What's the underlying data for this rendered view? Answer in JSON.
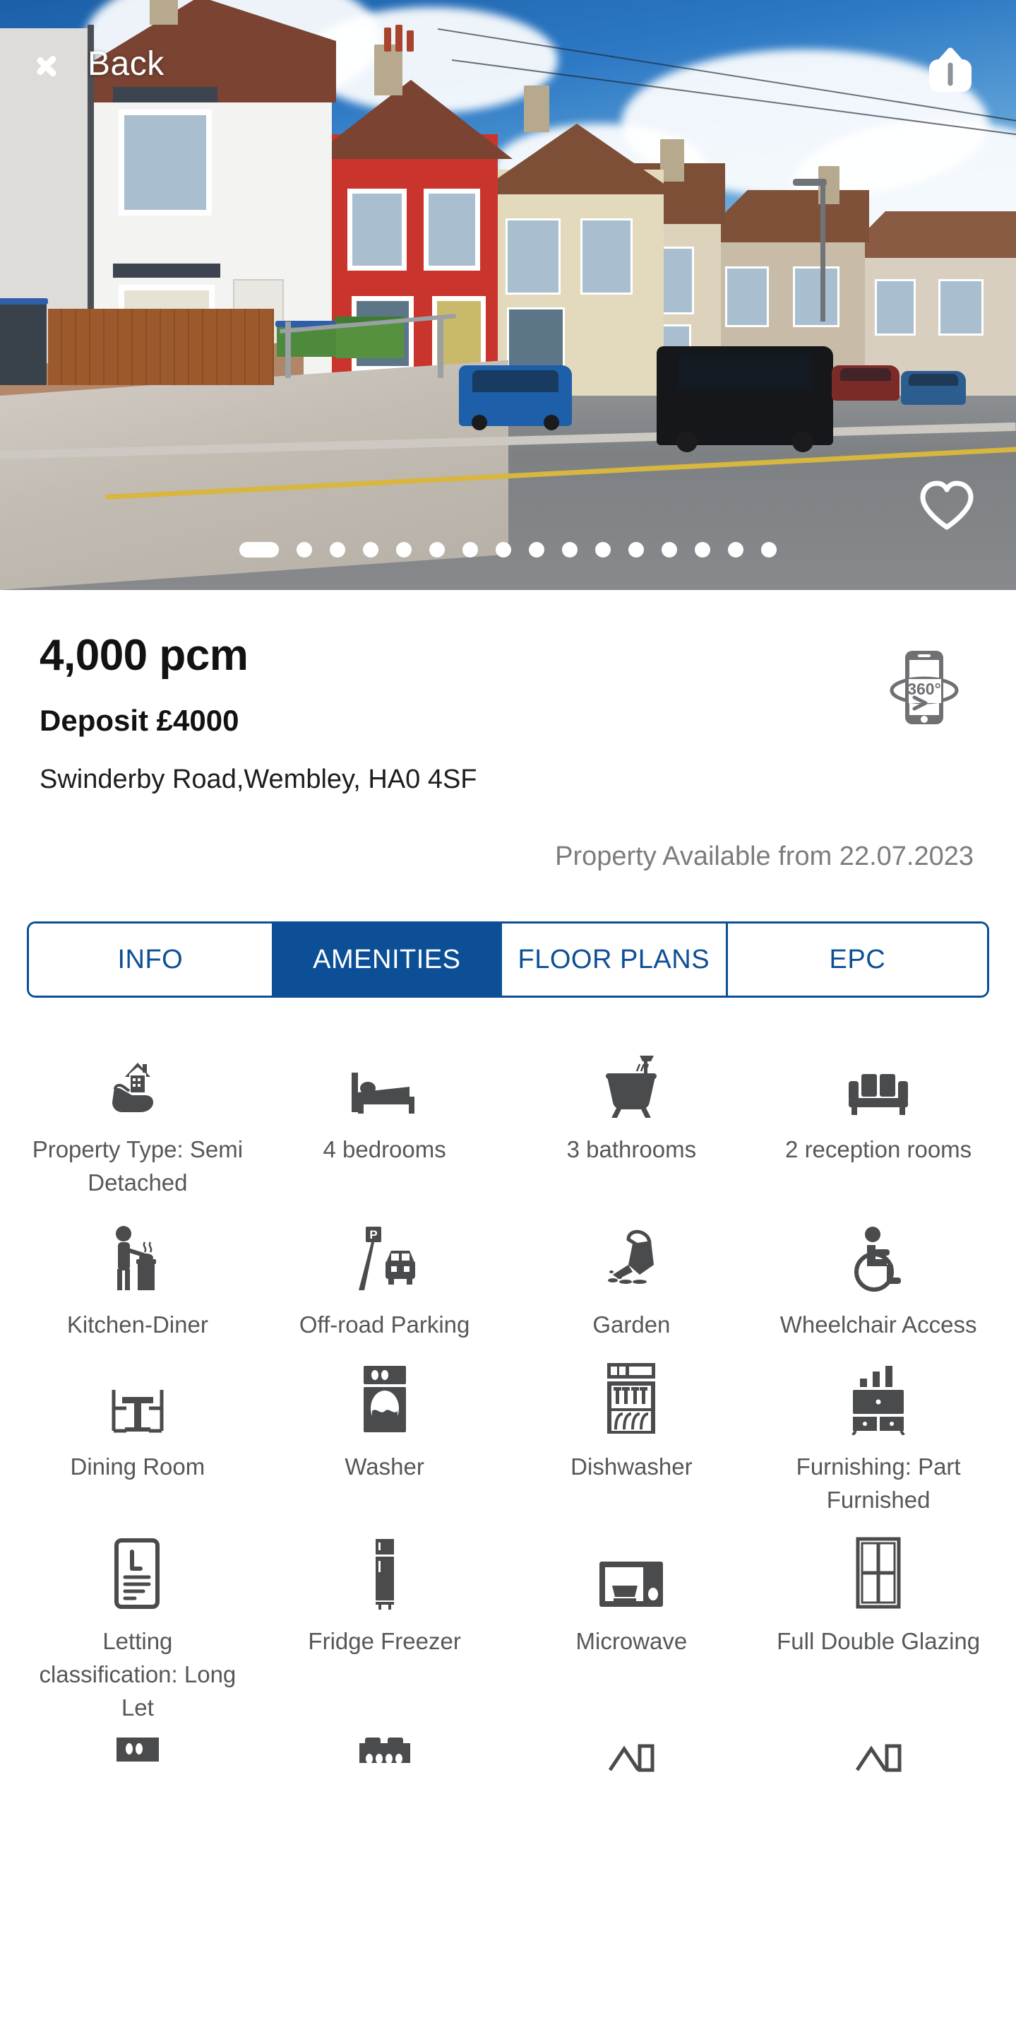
{
  "header": {
    "back_label": "Back",
    "back_icon": "chevron-left-icon",
    "share_icon": "share-upload-icon",
    "favorite_icon": "heart-outline-icon"
  },
  "carousel": {
    "total_dots": 16,
    "active_index": 0
  },
  "property": {
    "price": "4,000 pcm",
    "deposit": "Deposit £4000",
    "address": "Swinderby Road,Wembley, HA0 4SF",
    "availability": "Property Available from 22.07.2023",
    "tour_icon": "360-virtual-tour-icon",
    "tour_icon_label": "360°"
  },
  "tabs": [
    {
      "label": "INFO",
      "active": false
    },
    {
      "label": "AMENITIES",
      "active": true
    },
    {
      "label": "FLOOR PLANS",
      "active": false
    },
    {
      "label": "EPC",
      "active": false
    }
  ],
  "amenities": [
    {
      "label": "Property Type: Semi Detached",
      "icon": "house-in-hand-icon"
    },
    {
      "label": "4 bedrooms",
      "icon": "bed-icon"
    },
    {
      "label": "3 bathrooms",
      "icon": "bathtub-shower-icon"
    },
    {
      "label": "2 reception rooms",
      "icon": "sofa-icon"
    },
    {
      "label": "Kitchen-Diner",
      "icon": "person-cooking-icon"
    },
    {
      "label": "Off-road Parking",
      "icon": "parking-car-icon"
    },
    {
      "label": "Garden",
      "icon": "watering-can-icon"
    },
    {
      "label": "Wheelchair Access",
      "icon": "wheelchair-icon"
    },
    {
      "label": "Dining Room",
      "icon": "dining-table-icon"
    },
    {
      "label": "Washer",
      "icon": "washing-machine-icon"
    },
    {
      "label": "Dishwasher",
      "icon": "dishwasher-icon"
    },
    {
      "label": "Furnishing: Part Furnished",
      "icon": "furniture-cabinet-icon"
    },
    {
      "label": "Letting classification: Long Let",
      "icon": "document-letting-icon"
    },
    {
      "label": "Fridge Freezer",
      "icon": "fridge-freezer-icon"
    },
    {
      "label": "Microwave",
      "icon": "microwave-icon"
    },
    {
      "label": "Full Double Glazing",
      "icon": "window-glazing-icon"
    }
  ],
  "amenities_partial_row": [
    {
      "icon": "oven-icon"
    },
    {
      "icon": "hob-cooker-icon"
    },
    {
      "icon": "house-feature-icon"
    },
    {
      "icon": "house-feature-icon"
    }
  ],
  "colors": {
    "brand_blue": "#0d4f96",
    "icon_gray": "#4a4b4d",
    "label_gray": "#555759",
    "muted_gray": "#7c7c7c"
  }
}
